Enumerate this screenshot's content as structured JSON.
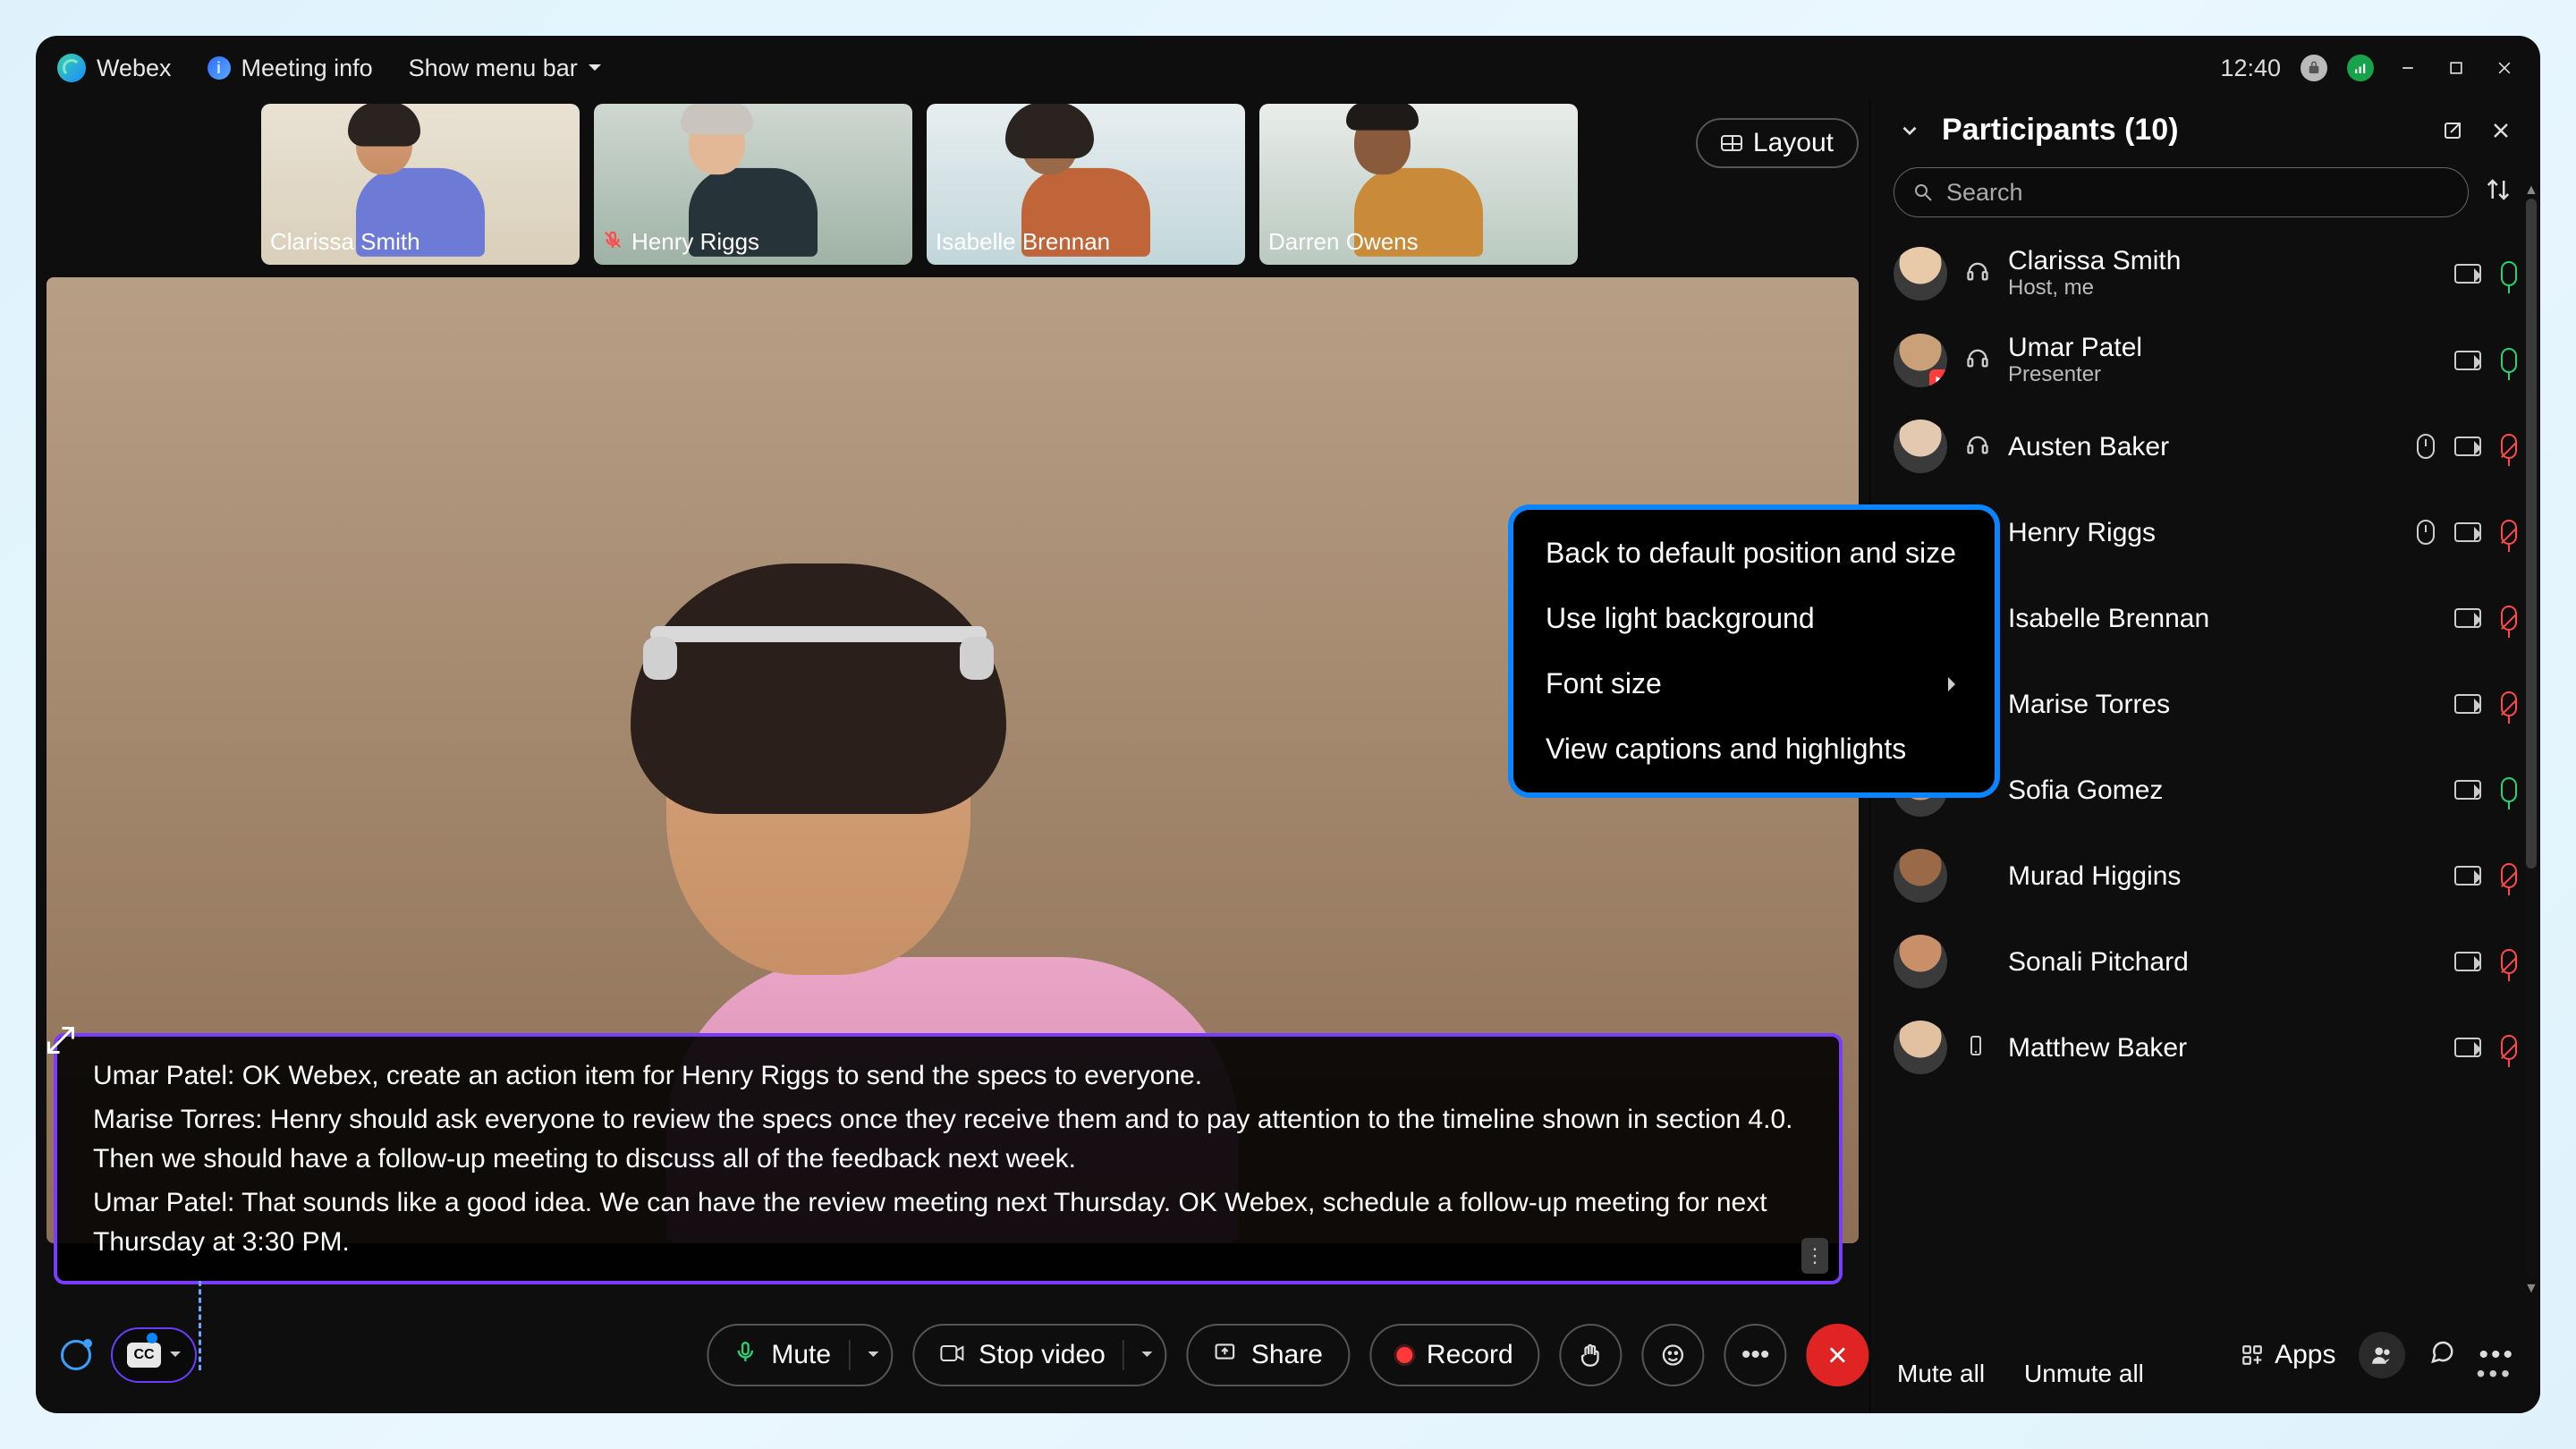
{
  "titlebar": {
    "app": "Webex",
    "meeting_info": "Meeting info",
    "menu": "Show menu bar",
    "clock": "12:40"
  },
  "layout_label": "Layout",
  "thumbs": [
    {
      "name": "Clarissa Smith",
      "muted": false
    },
    {
      "name": "Henry Riggs",
      "muted": true
    },
    {
      "name": "Isabelle Brennan",
      "muted": false
    },
    {
      "name": "Darren Owens",
      "muted": false
    }
  ],
  "captions": {
    "lines": [
      {
        "speaker": "Umar Patel",
        "text": "OK Webex, create an action item for Henry Riggs to send the specs to everyone."
      },
      {
        "speaker": "Marise Torres",
        "text": "Henry should ask everyone to review the specs once they receive them and to pay attention to the timeline shown in section 4.0. Then we should have a follow-up meeting to discuss all of the feedback next week."
      },
      {
        "speaker": "Umar Patel",
        "text": "That sounds like a good idea. We can have the review meeting next Thursday. OK Webex, schedule a follow-up meeting for next Thursday at 3:30 PM."
      }
    ]
  },
  "context_menu": {
    "items": [
      "Back to default position and size",
      "Use light background",
      "Font size",
      "View captions and highlights"
    ]
  },
  "toolbar": {
    "mute": "Mute",
    "stop_video": "Stop video",
    "share": "Share",
    "record": "Record",
    "apps": "Apps",
    "cc": "CC"
  },
  "panel": {
    "title": "Participants (10)",
    "search_placeholder": "Search",
    "mute_all": "Mute all",
    "unmute_all": "Unmute all",
    "list": [
      {
        "name": "Clarissa Smith",
        "sub": "Host, me",
        "device": "headset",
        "mic": "live",
        "mouse": false,
        "alert": false
      },
      {
        "name": "Umar Patel",
        "sub": "Presenter",
        "device": "headset",
        "mic": "live",
        "mouse": false,
        "alert": true
      },
      {
        "name": "Austen Baker",
        "sub": "",
        "device": "headset",
        "mic": "muted",
        "mouse": true,
        "alert": false
      },
      {
        "name": "Henry Riggs",
        "sub": "",
        "device": "headset",
        "mic": "muted",
        "mouse": true,
        "alert": false
      },
      {
        "name": "Isabelle Brennan",
        "sub": "",
        "device": "phone",
        "mic": "muted",
        "mouse": false,
        "alert": false
      },
      {
        "name": "Marise Torres",
        "sub": "",
        "device": "",
        "mic": "muted",
        "mouse": false,
        "alert": false
      },
      {
        "name": "Sofia Gomez",
        "sub": "",
        "device": "",
        "mic": "live",
        "mouse": false,
        "alert": false
      },
      {
        "name": "Murad Higgins",
        "sub": "",
        "device": "",
        "mic": "muted",
        "mouse": false,
        "alert": false
      },
      {
        "name": "Sonali Pitchard",
        "sub": "",
        "device": "",
        "mic": "muted",
        "mouse": false,
        "alert": false
      },
      {
        "name": "Matthew Baker",
        "sub": "",
        "device": "phone",
        "mic": "muted",
        "mouse": false,
        "alert": false
      }
    ]
  }
}
